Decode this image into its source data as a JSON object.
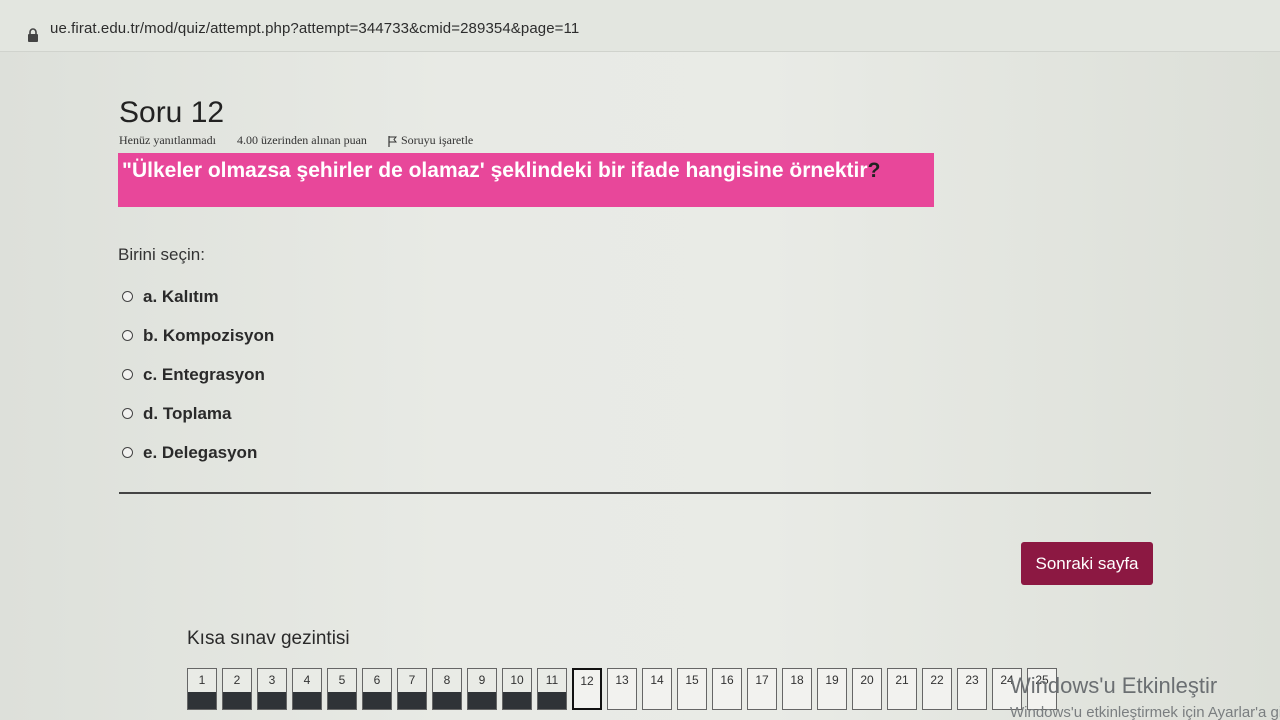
{
  "browser": {
    "url": "ue.firat.edu.tr/mod/quiz/attempt.php?attempt=344733&cmid=289354&page=11"
  },
  "question": {
    "title": "Soru 12",
    "status": "Henüz yanıtlanmadı",
    "points": "4.00 üzerinden alınan puan",
    "flag_label": "Soruyu işaretle",
    "text": "\"Ülkeler olmazsa  şehirler de olamaz' şeklindeki bir ifade hangisine örnektir",
    "text_end": "?",
    "prompt": "Birini seçin:",
    "options": [
      {
        "label": "a. Kalıtım"
      },
      {
        "label": "b. Kompozisyon"
      },
      {
        "label": "c. Entegrasyon"
      },
      {
        "label": "d. Toplama"
      },
      {
        "label": "e. Delegasyon"
      }
    ]
  },
  "next_button": "Sonraki sayfa",
  "navigation": {
    "title": "Kısa sınav gezintisi",
    "items": [
      "1",
      "2",
      "3",
      "4",
      "5",
      "6",
      "7",
      "8",
      "9",
      "10",
      "11",
      "12",
      "13",
      "14",
      "15",
      "16",
      "17",
      "18",
      "19",
      "20",
      "21",
      "22",
      "23",
      "24",
      "25"
    ],
    "answered": [
      "1",
      "2",
      "3",
      "4",
      "5",
      "6",
      "7",
      "8",
      "9",
      "10",
      "11"
    ],
    "current": "12"
  },
  "watermark": {
    "title": "Windows'u Etkinleştir",
    "subtitle": "Windows'u etkinleştirmek için Ayarlar'a gidin."
  }
}
